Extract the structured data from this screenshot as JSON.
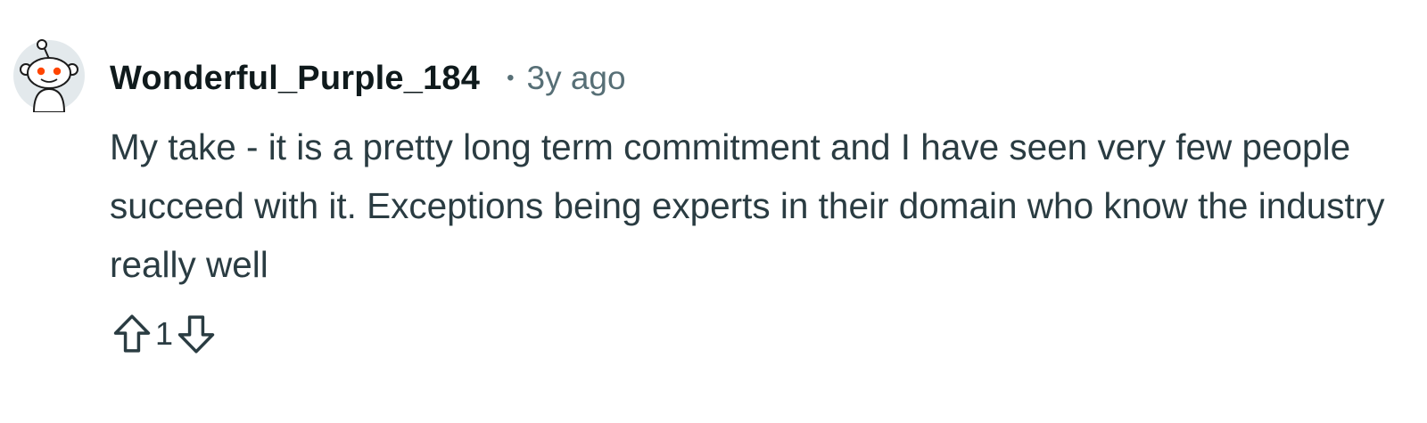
{
  "comment": {
    "author": "Wonderful_Purple_184",
    "separator": "•",
    "timestamp": "3y ago",
    "body": "My take - it is a pretty long term commitment and I have seen very few people succeed with it. Exceptions being experts in their domain who know the industry really well",
    "avatar_icon": "reddit-snoo-avatar-icon"
  },
  "actions": {
    "upvote_icon": "upvote-arrow-icon",
    "vote_count": "1",
    "downvote_icon": "downvote-arrow-icon"
  },
  "colors": {
    "username": "#0f1a1c",
    "meta": "#576f76",
    "body": "#2a3c42",
    "avatar_eye": "#ff4500"
  }
}
